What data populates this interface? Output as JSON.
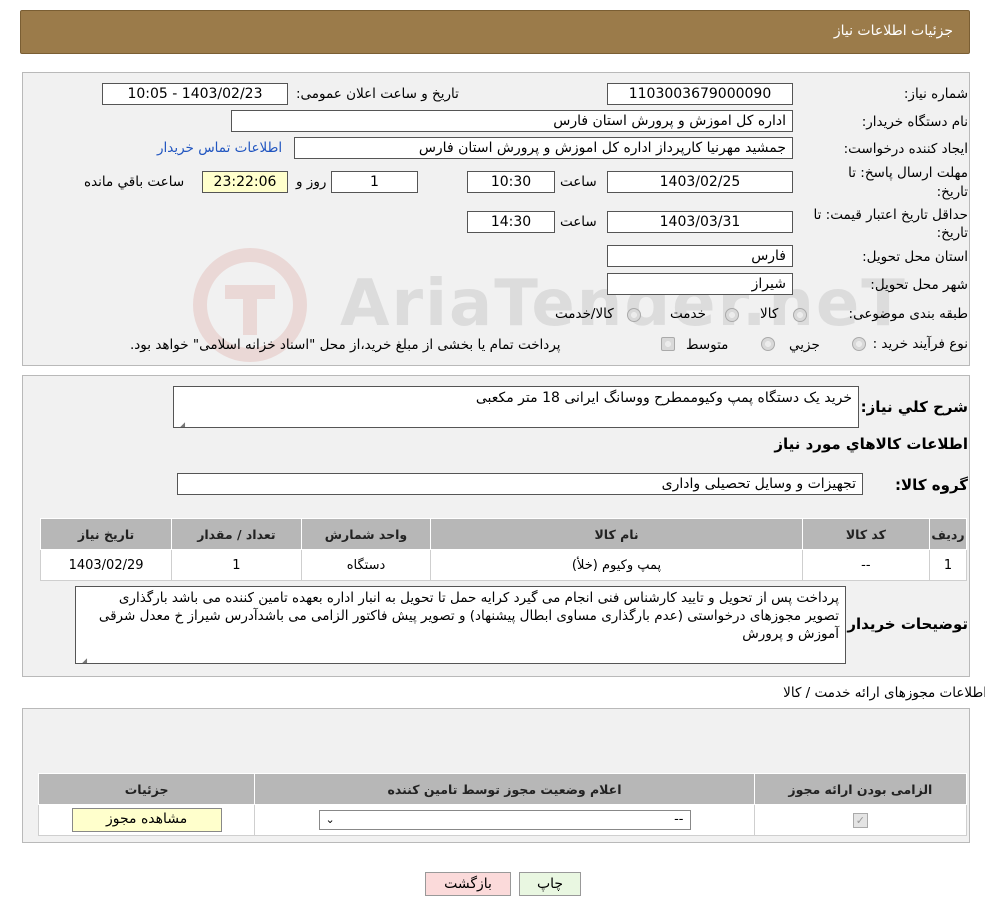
{
  "header": {
    "title": "جزئیات اطلاعات نیاز"
  },
  "form": {
    "need_number_label": "شماره نیاز:",
    "need_number": "1103003679000090",
    "announce_label": "تاریخ و ساعت اعلان عمومی:",
    "announce_value": "1403/02/23 - 10:05",
    "buyer_org_label": "نام دستگاه خریدار:",
    "buyer_org": "اداره کل اموزش و پرورش استان فارس",
    "requester_label": "ایجاد کننده درخواست:",
    "requester": "جمشید مهرنیا کارپرداز اداره کل اموزش و پرورش استان فارس",
    "buyer_contact_link": "اطلاعات تماس خریدار",
    "deadline_label_1": "مهلت ارسال پاسخ: تا",
    "deadline_label_2": "تاریخ:",
    "deadline_date": "1403/02/25",
    "time_label": "ساعت",
    "deadline_time": "10:30",
    "days_value": "1",
    "days_label": "روز و",
    "remaining_time": "23:22:06",
    "remaining_label": "ساعت باقي مانده",
    "validity_label_1": "حداقل تاریخ اعتبار قیمت: تا",
    "validity_label_2": "تاریخ:",
    "validity_date": "1403/03/31",
    "validity_time": "14:30",
    "province_label": "استان محل تحویل:",
    "province": "فارس",
    "city_label": "شهر محل تحویل:",
    "city": "شیراز",
    "category_label": "طبقه بندی موضوعی:",
    "category_options": [
      "کالا",
      "خدمت",
      "کالا/خدمت"
    ],
    "process_label": "نوع فرآیند خرید :",
    "process_options": [
      "جزیي",
      "متوسط"
    ],
    "process_note": "پرداخت تمام یا بخشی از مبلغ خرید،از محل \"اسناد خزانه اسلامی\" خواهد بود."
  },
  "details": {
    "description_label": "شرح کلي نیاز:",
    "description": "خرید یک دستگاه پمپ وکیوممطرح ووسانگ ایرانی 18 متر مکعبی",
    "goods_info_title": "اطلاعات کالاهاي مورد نیاز",
    "goods_group_label": "گروه کالا:",
    "goods_group": "تجهیزات و وسایل تحصیلی واداری",
    "table": {
      "headers": [
        "ردیف",
        "کد کالا",
        "نام کالا",
        "واحد شمارش",
        "تعداد / مقدار",
        "تاریخ نیاز"
      ],
      "rows": [
        [
          "1",
          "--",
          "پمپ وکیوم (خلأ)",
          "دستگاه",
          "1",
          "1403/02/29"
        ]
      ]
    },
    "buyer_notes_label": "توضیحات خریدار:",
    "buyer_notes": "پرداخت پس از تحویل و تایید کارشناس فنی انجام می گیرد  کرایه حمل تا تحویل به انبار اداره بعهده تامین کننده می باشد بارگذاری تصویر مجوزهای درخواستی (عدم بارگذاری مساوی ابطال پیشنهاد) و تصویر پیش فاکتور الزامی می باشدآدرس شیراز خ معدل شرقی آموزش و پرورش"
  },
  "permits": {
    "title": "اطلاعات مجوزهای ارائه خدمت / کالا",
    "headers": [
      "الزامی بودن ارائه مجوز",
      "اعلام وضعیت مجوز توسط تامین کننده",
      "جزئیات"
    ],
    "select_value": "--",
    "view_button": "مشاهده مجوز"
  },
  "buttons": {
    "print": "چاپ",
    "back": "بازگشت"
  },
  "watermark": {
    "text": "AriaTender.neT"
  }
}
